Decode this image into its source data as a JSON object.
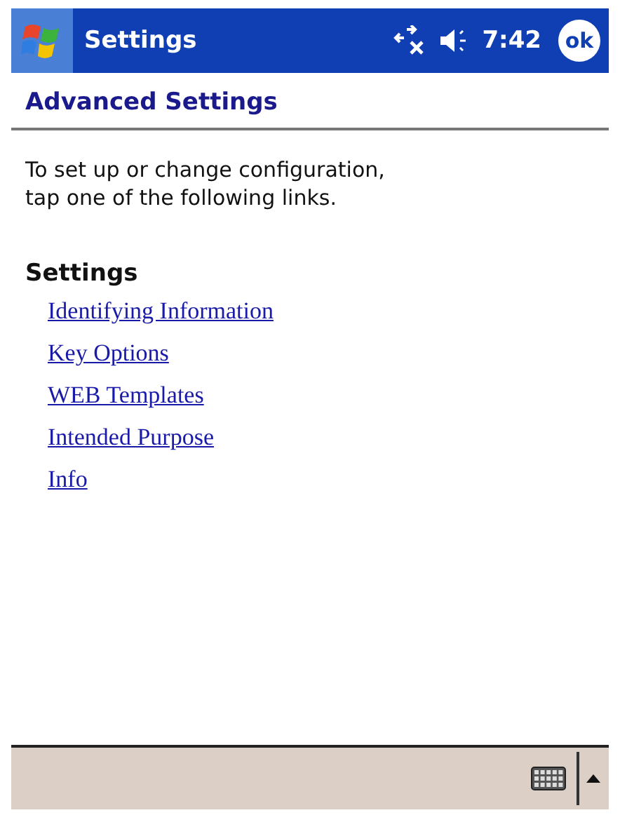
{
  "title_bar": {
    "title": "Settings",
    "time": "7:42",
    "ok_label": "ok"
  },
  "page": {
    "heading": "Advanced Settings",
    "intro_lines": [
      "To set up or change configuration,",
      "tap one of the following links."
    ],
    "section_title": "Settings",
    "links": [
      "Identifying Information",
      "Key Options",
      "WEB Templates",
      "Intended Purpose",
      "Info"
    ]
  },
  "menu_bar": {
    "input_panel_open": false
  }
}
